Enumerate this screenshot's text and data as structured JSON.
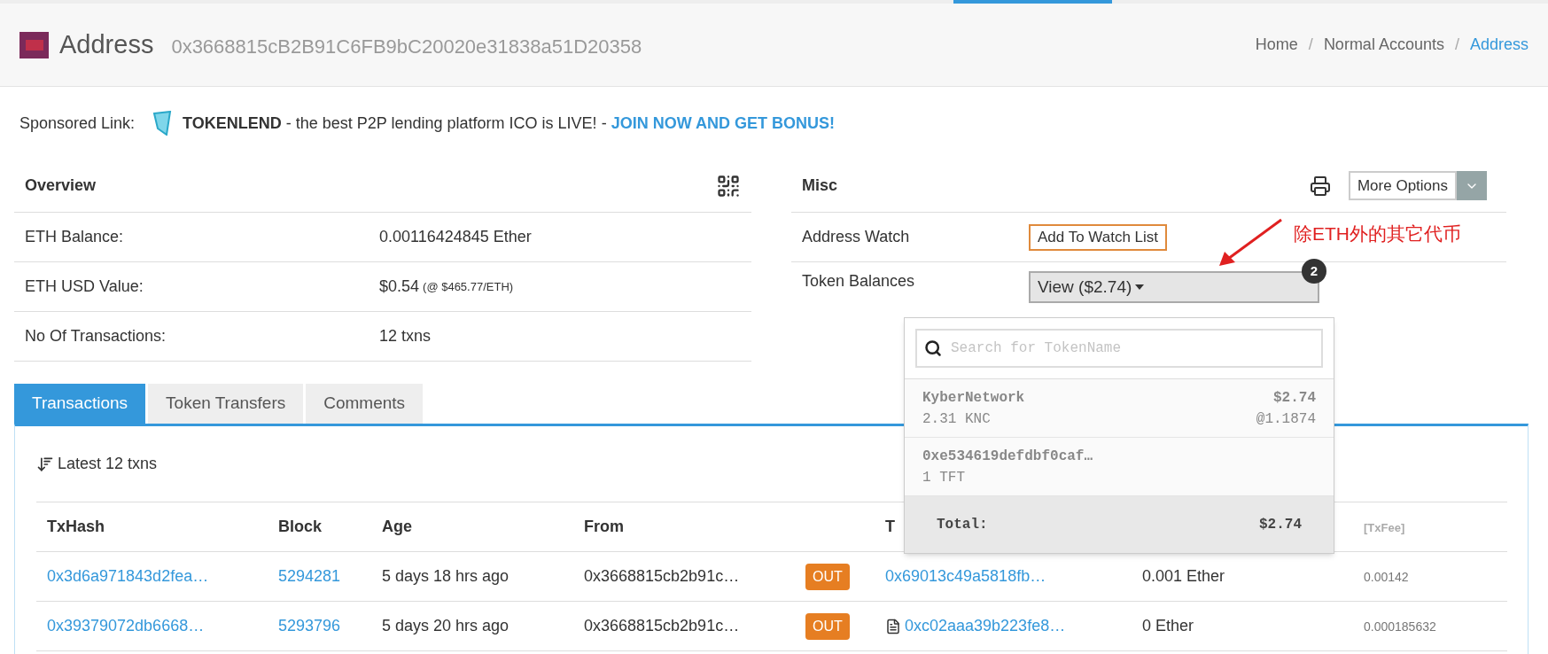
{
  "header": {
    "title": "Address",
    "address": "0x3668815cB2B91C6FB9bC20020e31838a51D20358",
    "separator": "/",
    "breadcrumb": [
      {
        "label": "Home",
        "selected": false
      },
      {
        "label": "Normal Accounts",
        "selected": false
      },
      {
        "label": "Address",
        "selected": true
      }
    ]
  },
  "sponsored": {
    "label": "Sponsored Link:",
    "brand": "TOKENLEND",
    "text": " - the best P2P lending platform ICO is LIVE! - ",
    "link": "JOIN NOW AND GET BONUS!"
  },
  "overview": {
    "title": "Overview",
    "rows": [
      {
        "label": "ETH Balance:",
        "value": "0.00116424845 Ether"
      },
      {
        "label": "ETH USD Value:",
        "value": "$0.54",
        "note": "(@ $465.77/ETH)"
      },
      {
        "label": "No Of Transactions:",
        "value": "12 txns"
      }
    ]
  },
  "misc": {
    "title": "Misc",
    "more_options": "More Options",
    "rows": [
      {
        "kind": "watch",
        "label": "Address Watch",
        "button": "Add To Watch List"
      },
      {
        "kind": "tokens",
        "label": "Token Balances",
        "button": "View ($2.74)",
        "badge": "2"
      }
    ]
  },
  "annotation": {
    "text": "除ETH外的其它代币"
  },
  "token_dropdown": {
    "placeholder": "Search for TokenName",
    "tokens": [
      {
        "name": "KyberNetwork",
        "amount": "2.31 KNC",
        "value": "$2.74",
        "rate": "@1.1874"
      },
      {
        "name": "0xe534619defdbf0caf…",
        "amount": "1 TFT"
      }
    ],
    "total_label": "Total:",
    "total_value": "$2.74"
  },
  "tabs": [
    {
      "label": "Transactions",
      "selected": true
    },
    {
      "label": "Token Transfers",
      "selected": false
    },
    {
      "label": "Comments",
      "selected": false
    }
  ],
  "transactions": {
    "summary": "Latest 12 txns",
    "headers": {
      "txhash": "TxHash",
      "block": "Block",
      "age": "Age",
      "from": "From",
      "to": "T",
      "fee": "[TxFee]"
    },
    "rows": [
      {
        "txhash": "0x3d6a971843d2fea…",
        "block": "5294281",
        "age": "5 days 18 hrs ago",
        "from": "0x3668815cb2b91c…",
        "direction": "OUT",
        "contract": false,
        "to": "0x69013c49a5818fb…",
        "value": "0.001 Ether",
        "fee": "0.00142"
      },
      {
        "txhash": "0x39379072db6668…",
        "block": "5293796",
        "age": "5 days 20 hrs ago",
        "from": "0x3668815cb2b91c…",
        "direction": "OUT",
        "contract": true,
        "to": "0xc02aaa39b223fe8…",
        "value": "0 Ether",
        "fee": "0.000185632"
      }
    ]
  }
}
